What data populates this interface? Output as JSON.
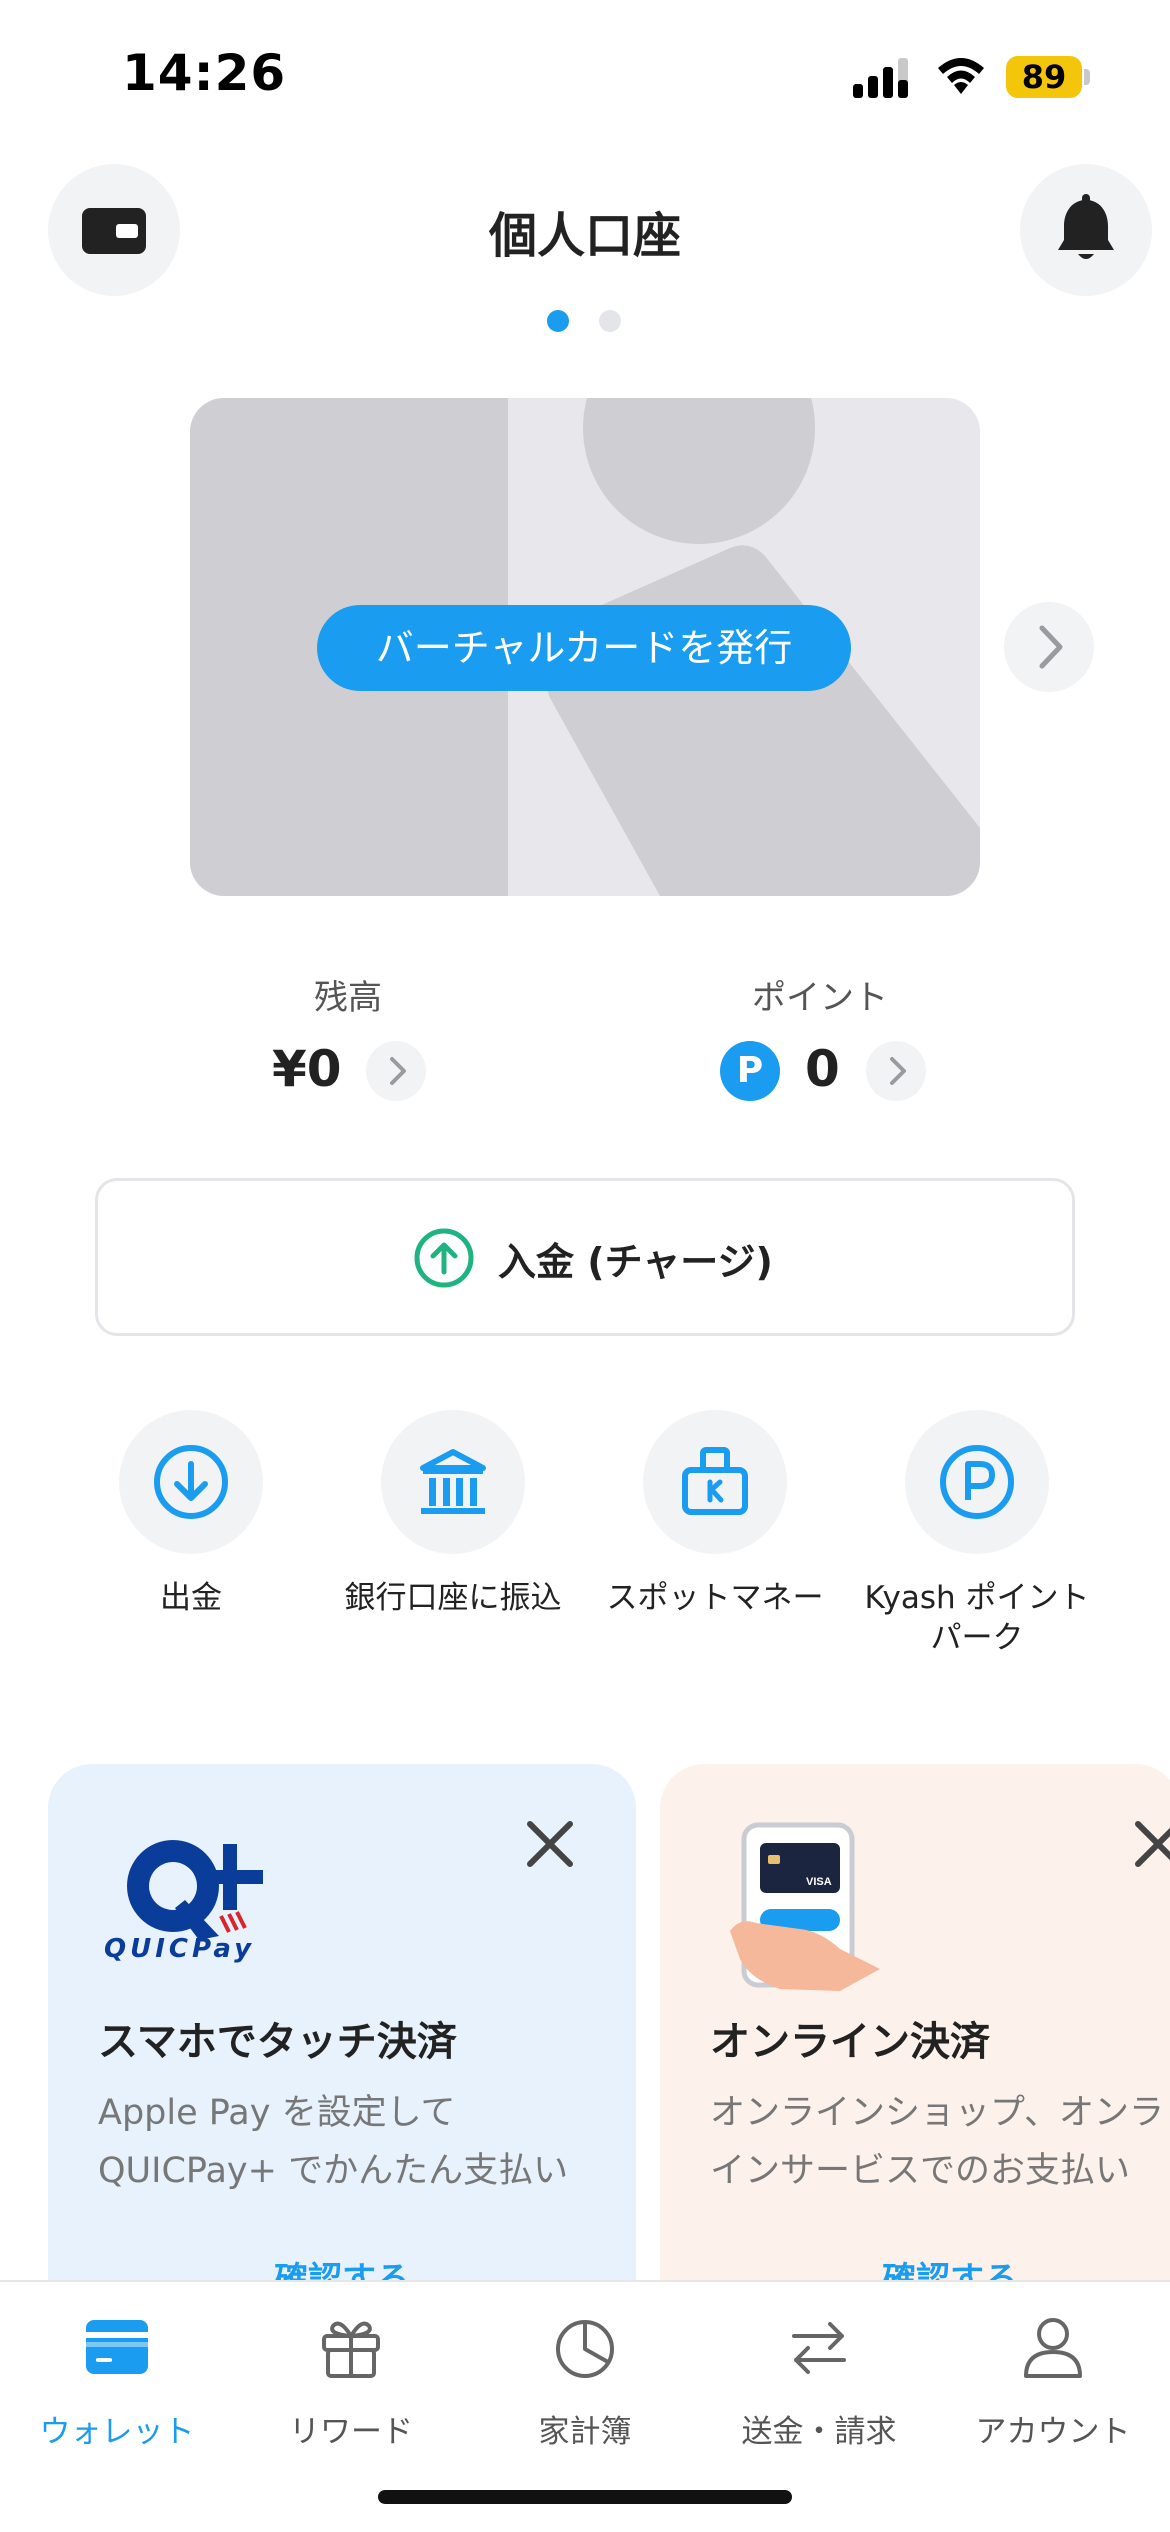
{
  "status_bar": {
    "time": "14:26",
    "battery": "89"
  },
  "header": {
    "title": "個人口座",
    "left_icon": "wallet-icon",
    "right_icon": "bell-icon"
  },
  "card": {
    "issue_button": "バーチャルカードを発行"
  },
  "balance": {
    "label": "残高",
    "value": "¥0"
  },
  "points": {
    "label": "ポイント",
    "icon": "P",
    "value": "0"
  },
  "deposit": {
    "label": "入金 (チャージ)"
  },
  "quick_actions": [
    {
      "label": "出金",
      "icon": "withdraw-icon"
    },
    {
      "label": "銀行口座に振込",
      "icon": "bank-icon"
    },
    {
      "label": "スポットマネー",
      "icon": "spot-money-icon"
    },
    {
      "label": "Kyash ポイント パーク",
      "icon": "point-park-icon"
    }
  ],
  "promos": [
    {
      "title": "スマホでタッチ決済",
      "desc_line1": "Apple Pay を設定して",
      "desc_line2": "QUICPay+ でかんたん支払い",
      "link": "確認する",
      "logo_text": "QUICPay"
    },
    {
      "title": "オンライン決済",
      "desc_line1": "オンラインショップ、オンラ",
      "desc_line2": "インサービスでのお支払い",
      "link": "確認する"
    }
  ],
  "tabs": [
    {
      "label": "ウォレット",
      "icon": "wallet-tab-icon",
      "active": true
    },
    {
      "label": "リワード",
      "icon": "gift-icon"
    },
    {
      "label": "家計簿",
      "icon": "pie-chart-icon"
    },
    {
      "label": "送金・請求",
      "icon": "transfer-icon"
    },
    {
      "label": "アカウント",
      "icon": "person-icon"
    }
  ],
  "colors": {
    "accent": "#1a9cf0",
    "green": "#1fb47f",
    "battery": "#f4c60b"
  }
}
